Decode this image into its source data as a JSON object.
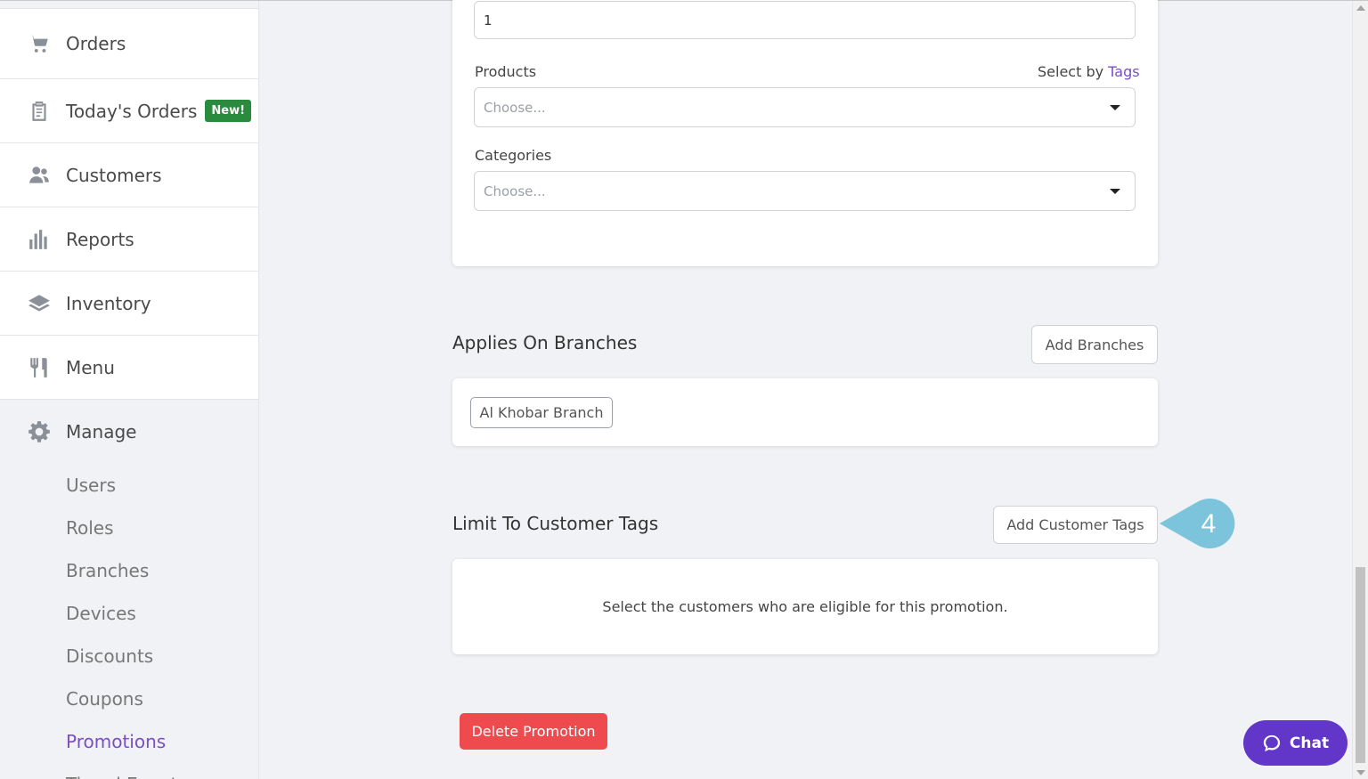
{
  "sidebar": {
    "items": [
      {
        "label": "Orders",
        "icon": "cart-icon"
      },
      {
        "label": "Today's Orders",
        "icon": "clipboard-icon",
        "badge": "New!"
      },
      {
        "label": "Customers",
        "icon": "users-icon"
      },
      {
        "label": "Reports",
        "icon": "bar-chart-icon"
      },
      {
        "label": "Inventory",
        "icon": "layers-icon"
      },
      {
        "label": "Menu",
        "icon": "utensils-icon"
      }
    ],
    "manage": {
      "label": "Manage",
      "icon": "gear-icon",
      "subitems": [
        "Users",
        "Roles",
        "Branches",
        "Devices",
        "Discounts",
        "Coupons",
        "Promotions",
        "Timed Events"
      ],
      "active": "Promotions"
    }
  },
  "form": {
    "quantity_value": "1",
    "products_label": "Products",
    "select_by_prefix": "Select by",
    "select_by_link": "Tags",
    "products_placeholder": "Choose...",
    "categories_label": "Categories",
    "categories_placeholder": "Choose..."
  },
  "branches": {
    "title": "Applies On Branches",
    "add_button": "Add Branches",
    "chips": [
      "Al Khobar Branch"
    ]
  },
  "customer_tags": {
    "title": "Limit To Customer Tags",
    "add_button": "Add Customer Tags",
    "empty_text": "Select the customers who are eligible for this promotion.",
    "callout_number": "4"
  },
  "actions": {
    "delete_button": "Delete Promotion"
  },
  "chat": {
    "label": "Chat"
  },
  "colors": {
    "accent": "#7b4fc4",
    "danger": "#ef4b4f",
    "chat": "#6236c9",
    "badge": "#2a8a3e",
    "callout": "#7cc3dc"
  }
}
